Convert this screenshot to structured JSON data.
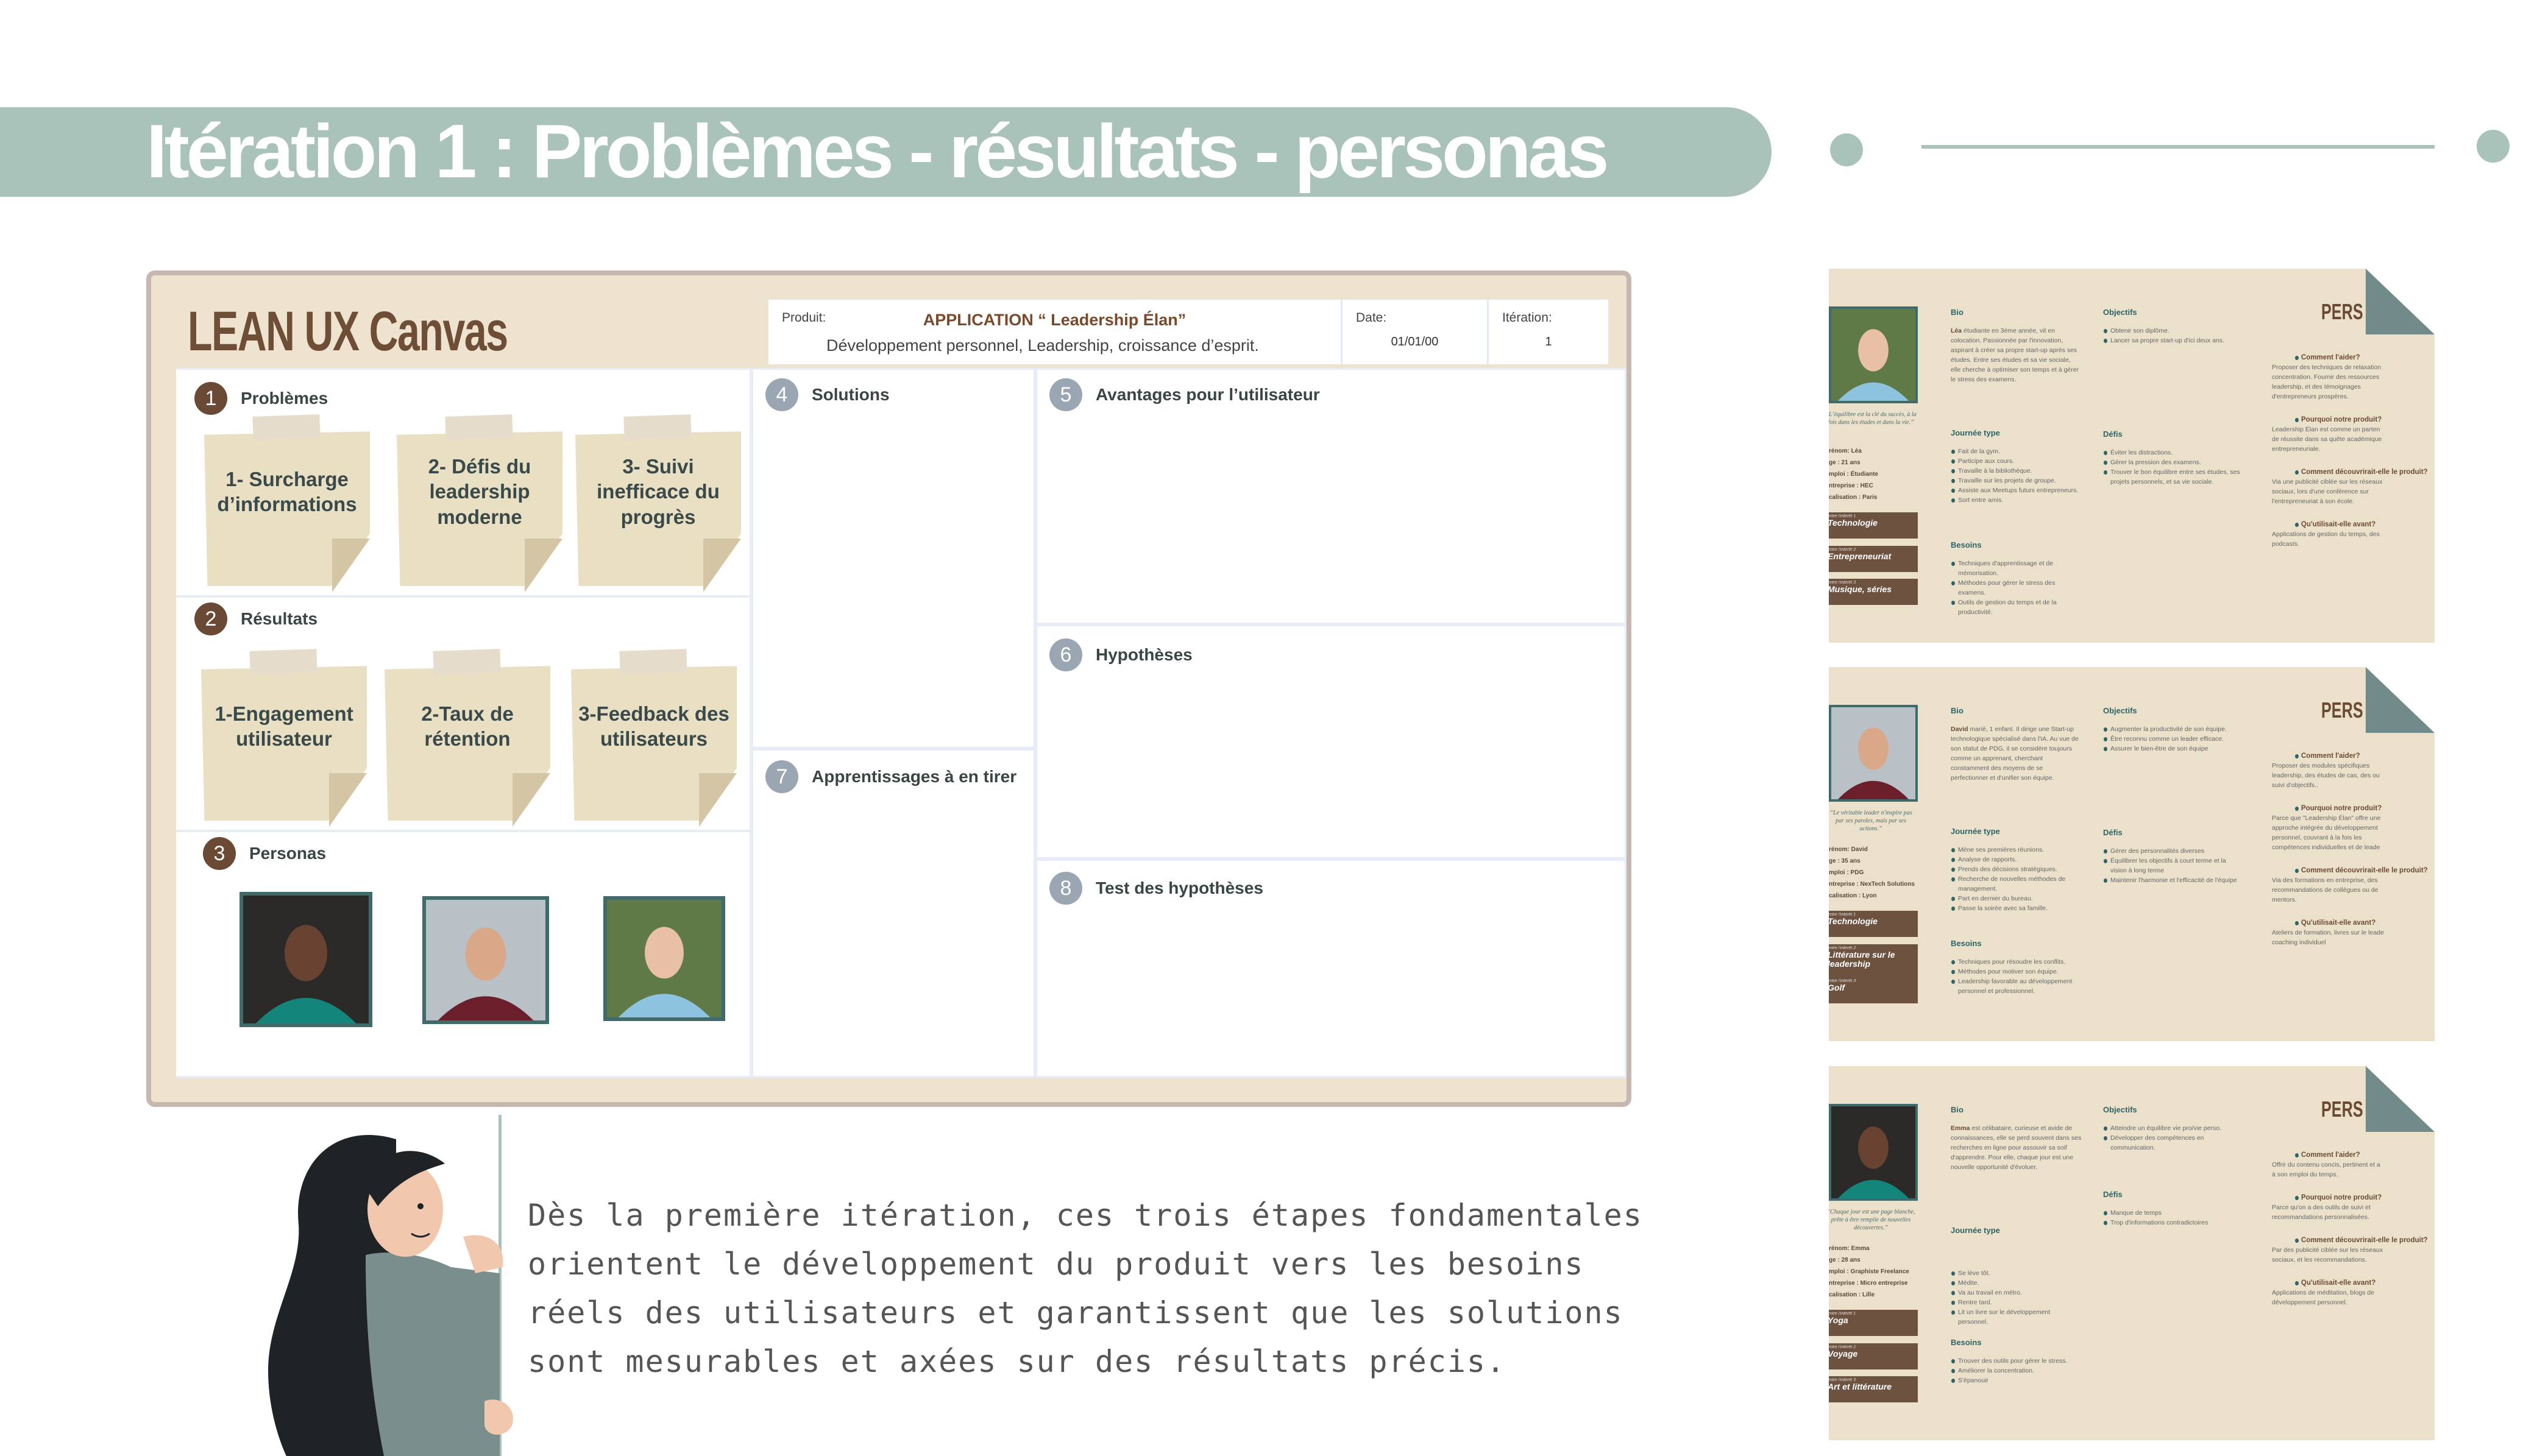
{
  "title": "Itération 1 : Problèmes - résultats - personas",
  "colors": {
    "accent": "#a9c3bb",
    "brown": "#6b4a35",
    "teal": "#3f6b6b",
    "beige": "#ede3cf"
  },
  "canvas": {
    "heading": "LEAN UX Canvas",
    "product_label": "Produit:",
    "product_name": "APPLICATION “ Leadership Élan”",
    "product_desc": "Développement personnel, Leadership, croissance d’esprit.",
    "date_label": "Date:",
    "date": "01/01/00",
    "iteration_label": "Itération:",
    "iteration": "1",
    "problems": {
      "num": "1",
      "label": "Problèmes",
      "notes": [
        "1- Surcharge d’informations",
        "2- Défis du leadership moderne",
        "3- Suivi inefficace du progrès"
      ]
    },
    "results": {
      "num": "2",
      "label": "Résultats",
      "notes": [
        "1-Engagement utilisateur",
        "2-Taux de rétention",
        "3-Feedback des utilisateurs"
      ]
    },
    "personas": {
      "num": "3",
      "label": "Personas",
      "photos": [
        "Emma",
        "David",
        "Léa"
      ]
    },
    "solutions": {
      "num": "4",
      "label": "Solutions"
    },
    "benefits": {
      "num": "5",
      "label": "Avantages pour l’utilisateur"
    },
    "hypotheses": {
      "num": "6",
      "label": "Hypothèses"
    },
    "learnings": {
      "num": "7",
      "label": "Apprentissages à en tirer"
    },
    "tests": {
      "num": "8",
      "label": "Test des hypothèses"
    }
  },
  "speech": "Dès la première itération, ces trois étapes fondamentales orientent le développement du produit vers les besoins réels des utilisateurs et garantissent que les solutions sont mesurables et axées sur des résultats précis.",
  "cards": [
    {
      "pers": "PERS",
      "quote": "“L’équilibre est la clé du succès, à la fois dans les études et dans la vie.”",
      "info": [
        "rénom: Léa",
        "ge : 21 ans",
        "mploi : Étudiante",
        "ntreprise : HEC",
        "calisation : Paris"
      ],
      "interests": [
        {
          "sub": "entre l'intérêt 1",
          "val": "Technologie"
        },
        {
          "sub": "entre l'intérêt 2",
          "val": "Entrepreneuriat"
        },
        {
          "sub": "entre l'intérêt 3",
          "val": "Musique, séries"
        }
      ],
      "bio_h": "Bio",
      "bio_name": "Léa",
      "bio": " étudiante en 3ème année, vit en colocation. Passionnée par l'innovation, aspirant à créer sa propre start-up après ses études. Entre ses études et sa vie sociale, elle cherche à optimiser son temps et à gérer le stress des examens.",
      "day_h": "Journée type",
      "day": [
        "Fait de la gym.",
        "Participe aux cours.",
        "Travaille à la bibliothèque.",
        "Travaille sur les projets de groupe.",
        "Assiste aux Meetups futurs entrepreneurs.",
        "Sort entre amis."
      ],
      "needs_h": "Besoins",
      "needs": [
        "Techniques d'apprentissage et de mémorisation.",
        "Méthodes pour gérer le stress des examens.",
        "Outils de gestion du temps et de la productivité."
      ],
      "goals_h": "Objectifs",
      "goals": [
        "Obtenir son diplôme.",
        "Lancer sa propre start-up d'ici deux ans."
      ],
      "chal_h": "Défis",
      "chal": [
        "Éviter les distractions.",
        "Gérer la pression des examens.",
        "Trouver le bon équilibre entre ses études, ses projets personnels, et sa vie sociale."
      ],
      "qa": [
        {
          "q": "Comment l'aider?",
          "a": [
            "Proposer des techniques de relaxation",
            "concentration. Fournir des ressources",
            "leadership, et des témoignages",
            "d'entrepreneurs prospères."
          ]
        },
        {
          "q": "Pourquoi notre produit?",
          "a": [
            "Leadership Élan est comme un parten",
            "de  réussite dans sa quête académique",
            "entrepreneuriale."
          ]
        },
        {
          "q": "Comment découvrirait-elle le produit?",
          "a": [
            "Via une publicité ciblée sur les réseaux",
            "sociaux, lors d'une conférence sur",
            "l'entrepreneuriat à son école."
          ]
        },
        {
          "q": "Qu'utilisait-elle avant?",
          "a": [
            "Applications de gestion du temps, des",
            "podcasts."
          ]
        }
      ]
    },
    {
      "pers": "PERS",
      "quote": "“Le véritable leader n'inspire pas par ses paroles, mais par ses actions.”",
      "info": [
        "rénom: David",
        "ge : 35 ans",
        "mploi : PDG",
        "ntreprise : NexTech Solutions",
        "calisation : Lyon"
      ],
      "interests": [
        {
          "sub": "entre l'intérêt 1",
          "val": "Technologie"
        },
        {
          "sub": "entre l'intérêt 2",
          "val": "Littérature sur le leadership"
        },
        {
          "sub": "entre l'intérêt 3",
          "val": "Golf"
        }
      ],
      "bio_h": "Bio",
      "bio_name": "David",
      "bio": " marié, 1 enfant. Il dirige une Start-up technologique spécialisé dans l'IA. Au vue de son statut de PDG, il se considère toujours comme un apprenant, cherchant constamment des moyens de se perfectionner et d'unifier son équipe.",
      "day_h": "Journée type",
      "day": [
        "Mène ses premières réunions.",
        "Analyse de rapports.",
        "Prends des décisions stratégiques.",
        "Recherche de nouvelles méthodes de management.",
        "Part en dernier du bureau.",
        "Passe la soirée avec sa famille."
      ],
      "needs_h": "Besoins",
      "needs": [
        "Techniques pour résoudre les conflits.",
        "Méthodes pour motiver son équipe.",
        "Leadership favorable au développement personnel et professionnel."
      ],
      "goals_h": "Objectifs",
      "goals": [
        "Augmenter la productivité de son équipe.",
        "Être reconnu comme un leader efficace.",
        "Assurer le bien-être de son équipe"
      ],
      "chal_h": "Défis",
      "chal": [
        "Gérer des personnalités diverses",
        "Équilibrer les objectifs à court terme et la vision à long terme",
        "Maintenir l'harmonie et l'efficacité de l'équipe"
      ],
      "qa": [
        {
          "q": "Comment l'aider?",
          "a": [
            "Proposer  des  modules  spécifiques",
            "leadership, des études de cas, des ou",
            "suivi d'objectifs.."
          ]
        },
        {
          "q": "Pourquoi notre produit?",
          "a": [
            "Parce que \"Leadership Élan\" offre une",
            "approche intégrée du développement",
            "personnel, couvrant à la fois les",
            "compétences individuelles et de leade"
          ]
        },
        {
          "q": "Comment découvrirait-elle le produit?",
          "a": [
            "Via des formations en entreprise, des",
            "recommandations de collègues ou de",
            "mentors."
          ]
        },
        {
          "q": "Qu'utilisait-elle avant?",
          "a": [
            "Ateliers de formation, livres sur le leade",
            "coaching individuel"
          ]
        }
      ]
    },
    {
      "pers": "PERS",
      "quote": "“Chaque jour est une page blanche, prête à être remplie de nouvelles découvertes.”",
      "info": [
        "rénom: Emma",
        "ge : 28 ans",
        "mploi : Graphiste Freelance",
        "ntreprise : Micro entreprise",
        "calisation : Lille"
      ],
      "interests": [
        {
          "sub": "entre l'intérêt 1",
          "val": "Yoga"
        },
        {
          "sub": "entre l'intérêt 2",
          "val": "Voyage"
        },
        {
          "sub": "entre l'intérêt 3",
          "val": "Art et littérature"
        }
      ],
      "bio_h": "Bio",
      "bio_name": "Emma",
      "bio": " est célibataire, curieuse et avide de connaissances, elle se perd souvent dans ses recherches en ligne pour assouvir sa soif d'apprendre. Pour elle, chaque jour est une nouvelle opportunité d'évoluer.",
      "day_h": "Journée type",
      "day": [
        "Se lève tôt.",
        "Médite.",
        "Va au travail en métro.",
        "Rentre tard.",
        "Lit un livre sur le développement personnel."
      ],
      "needs_h": "Besoins",
      "needs": [
        "Trouver des outils pour gérer le stress.",
        "Améliorer la concentration.",
        "S'épanouir"
      ],
      "goals_h": "Objectifs",
      "goals": [
        "Atteindre un équilibre vie pro/vie perso.",
        "Développer des compétences en communication."
      ],
      "chal_h": "Défis",
      "chal": [
        "Manque de temps",
        "Trop d'informations contradictoires"
      ],
      "qa": [
        {
          "q": "Comment l'aider?",
          "a": [
            "Offrir du contenu concis, pertinent et a",
            "à son emploi du temps."
          ]
        },
        {
          "q": "Pourquoi notre produit?",
          "a": [
            "Parce qu'on a des outils de suivi et",
            "recommandations personnalisées."
          ]
        },
        {
          "q": "Comment découvrirait-elle le produit?",
          "a": [
            "Par des publicité ciblée sur les réseaux",
            "sociaux, et les recommandations."
          ]
        },
        {
          "q": "Qu'utilisait-elle avant?",
          "a": [
            "Applications de méditation, blogs de",
            "développement personnel."
          ]
        }
      ]
    }
  ]
}
